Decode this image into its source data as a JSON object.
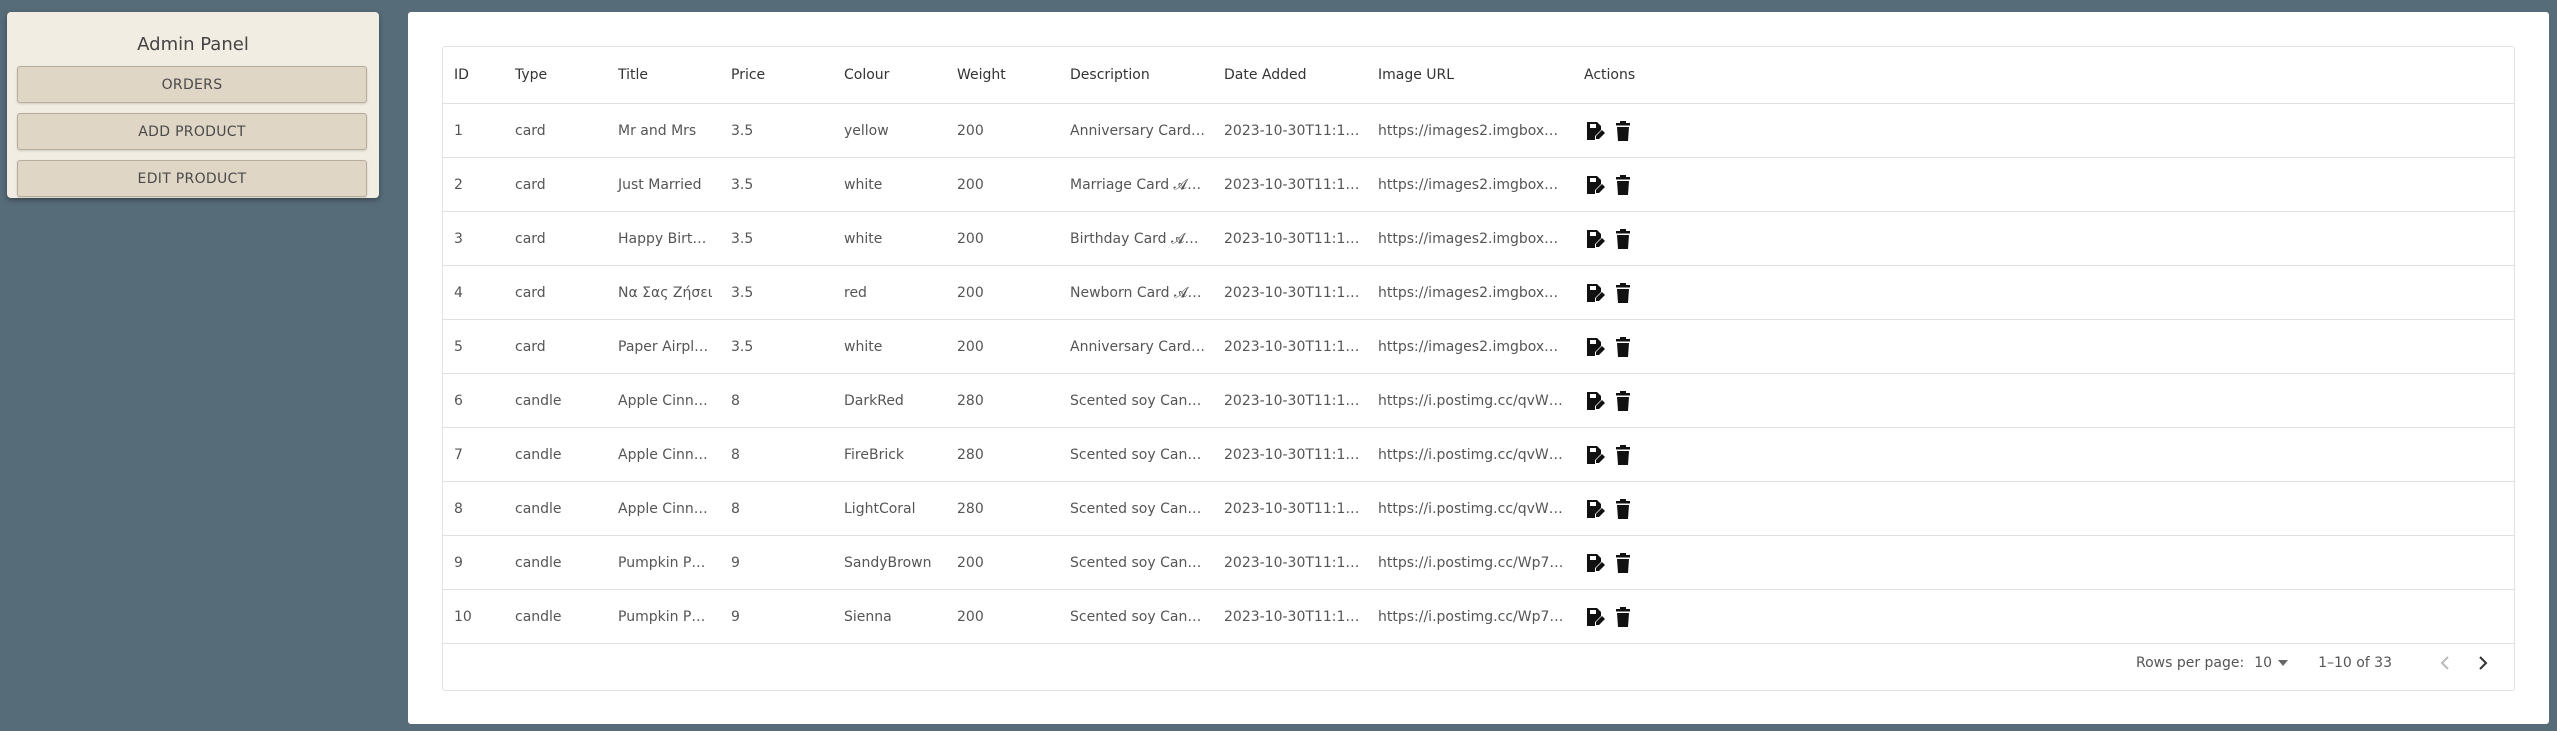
{
  "panel": {
    "title": "Admin Panel",
    "buttons": [
      "ORDERS",
      "ADD PRODUCT",
      "EDIT PRODUCT"
    ]
  },
  "table": {
    "columns": [
      "ID",
      "Type",
      "Title",
      "Price",
      "Colour",
      "Weight",
      "Description",
      "Date Added",
      "Image URL",
      "Actions"
    ],
    "rows": [
      [
        "1",
        "card",
        "Mr and Mrs",
        "3.5",
        "yellow",
        "200",
        "Anniversary Card…",
        "2023-10-30T11:13:…",
        "https://images2.imgbox…"
      ],
      [
        "2",
        "card",
        "Just Married",
        "3.5",
        "white",
        "200",
        "Marriage Card 𝓐…",
        "2023-10-30T11:13:…",
        "https://images2.imgbox…"
      ],
      [
        "3",
        "card",
        "Happy Birt…",
        "3.5",
        "white",
        "200",
        "Birthday Card 𝓐…",
        "2023-10-30T11:13:…",
        "https://images2.imgbox…"
      ],
      [
        "4",
        "card",
        "Να Σας Ζήσει",
        "3.5",
        "red",
        "200",
        "Newborn Card 𝓐…",
        "2023-10-30T11:13:…",
        "https://images2.imgbox…"
      ],
      [
        "5",
        "card",
        "Paper Airpl…",
        "3.5",
        "white",
        "200",
        "Anniversary Card…",
        "2023-10-30T11:13:…",
        "https://images2.imgbox…"
      ],
      [
        "6",
        "candle",
        "Apple Cinn…",
        "8",
        "DarkRed",
        "280",
        "Scented soy Can…",
        "2023-10-30T11:13:…",
        "https://i.postimg.cc/qvW…"
      ],
      [
        "7",
        "candle",
        "Apple Cinn…",
        "8",
        "FireBrick",
        "280",
        "Scented soy Can…",
        "2023-10-30T11:13:…",
        "https://i.postimg.cc/qvW…"
      ],
      [
        "8",
        "candle",
        "Apple Cinn…",
        "8",
        "LightCoral",
        "280",
        "Scented soy Can…",
        "2023-10-30T11:13:…",
        "https://i.postimg.cc/qvW…"
      ],
      [
        "9",
        "candle",
        "Pumpkin P…",
        "9",
        "SandyBrown",
        "200",
        "Scented soy Can…",
        "2023-10-30T11:13:…",
        "https://i.postimg.cc/Wp7…"
      ],
      [
        "10",
        "candle",
        "Pumpkin P…",
        "9",
        "Sienna",
        "200",
        "Scented soy Can…",
        "2023-10-30T11:13:…",
        "https://i.postimg.cc/Wp7…"
      ]
    ],
    "action_icons": [
      "edit-icon",
      "delete-icon"
    ]
  },
  "pagination": {
    "rows_per_page_label": "Rows per page:",
    "rows_per_page_value": "10",
    "range_label": "1–10 of 33",
    "prev_icon": "chevron-left-icon",
    "next_icon": "chevron-right-icon"
  },
  "colors": {
    "background": "#576c79",
    "panel": "#f2ede2",
    "panel_button": "#e0d6c6"
  }
}
